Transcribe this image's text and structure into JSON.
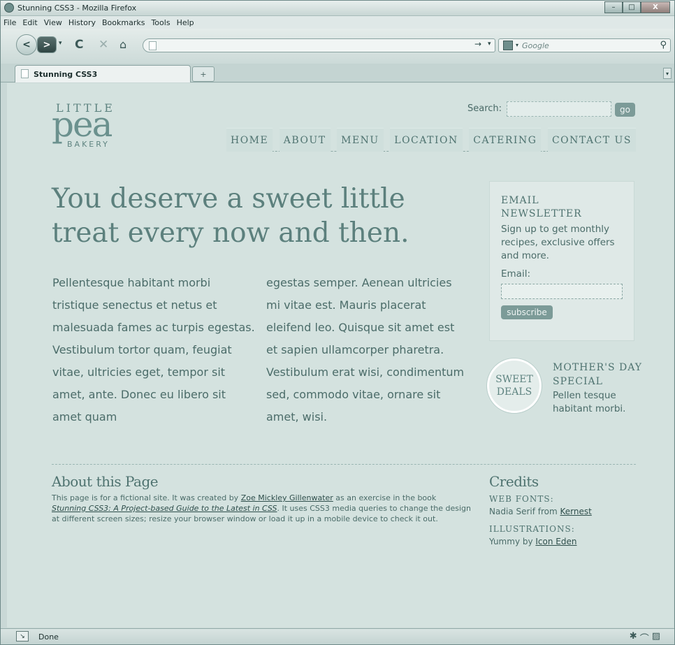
{
  "window": {
    "title": "Stunning CSS3 - Mozilla Firefox",
    "controls": {
      "minimize": "–",
      "maximize": "□",
      "close": "X"
    }
  },
  "menubar": [
    "File",
    "Edit",
    "View",
    "History",
    "Bookmarks",
    "Tools",
    "Help"
  ],
  "toolbar": {
    "back": "<",
    "forward": ">",
    "dropdown": "▾",
    "reload": "C",
    "stop": "✕",
    "home": "⌂",
    "url_value": "",
    "go": "→",
    "search_placeholder": "Google",
    "search_icon": "⚲"
  },
  "tabs": [
    {
      "label": "Stunning CSS3",
      "active": true
    }
  ],
  "newtab_label": "+",
  "page": {
    "logo": {
      "little": "LITTLE",
      "pea": "pea",
      "bakery": "BAKERY"
    },
    "search": {
      "label": "Search:",
      "value": "",
      "button": "go"
    },
    "nav": [
      "HOME",
      "ABOUT",
      "MENU",
      "LOCATION",
      "CATERING",
      "CONTACT US"
    ],
    "headline": "You deserve a sweet little treat every now and then.",
    "body_col1": "Pellentesque habitant morbi tristique senectus et netus et malesuada fames ac turpis egestas. Vestibulum tortor quam, feugiat vitae, ultricies eget, tempor sit amet, ante. Donec eu libero sit amet quam",
    "body_col2": "egestas semper. Aenean ultricies mi vitae est. Mauris placerat eleifend leo. Quisque sit amet est et sapien ullamcorper pharetra. Vestibulum erat wisi, condimentum sed, commodo vitae, ornare sit amet, wisi.",
    "newsletter": {
      "title": "EMAIL NEWSLETTER",
      "text": "Sign up to get monthly recipes, exclusive offers and more.",
      "email_label": "Email:",
      "email_value": "",
      "button": "subscribe"
    },
    "deals": {
      "badge": "SWEET DEALS",
      "title": "MOTHER'S DAY SPECIAL",
      "text": "Pellen tesque habitant morbi."
    },
    "about": {
      "title": "About this Page",
      "text_1": "This page is for a fictional site. It was created by ",
      "link_author": "Zoe Mickley Gillenwater",
      "text_2": " as an exercise in the book ",
      "link_book": "Stunning CSS3: A Project-based Guide to the Latest in CSS",
      "text_3": ". It uses CSS3 media queries to change the design at different screen sizes; resize your browser window or load it up in a mobile device to check it out."
    },
    "credits": {
      "title": "Credits",
      "web_fonts_label": "WEB FONTS:",
      "web_fonts_text": "Nadia Serif from ",
      "web_fonts_link": "Kernest",
      "illustrations_label": "ILLUSTRATIONS:",
      "illustrations_text": "Yummy by ",
      "illustrations_link": "Icon Eden"
    }
  },
  "status": {
    "text": "Done"
  },
  "icons": {
    "firefox": "firefox-icon",
    "back": "back-arrow-icon",
    "forward": "forward-arrow-icon",
    "reload": "reload-icon",
    "stop": "stop-icon",
    "home": "home-icon",
    "search": "magnifier-icon"
  }
}
